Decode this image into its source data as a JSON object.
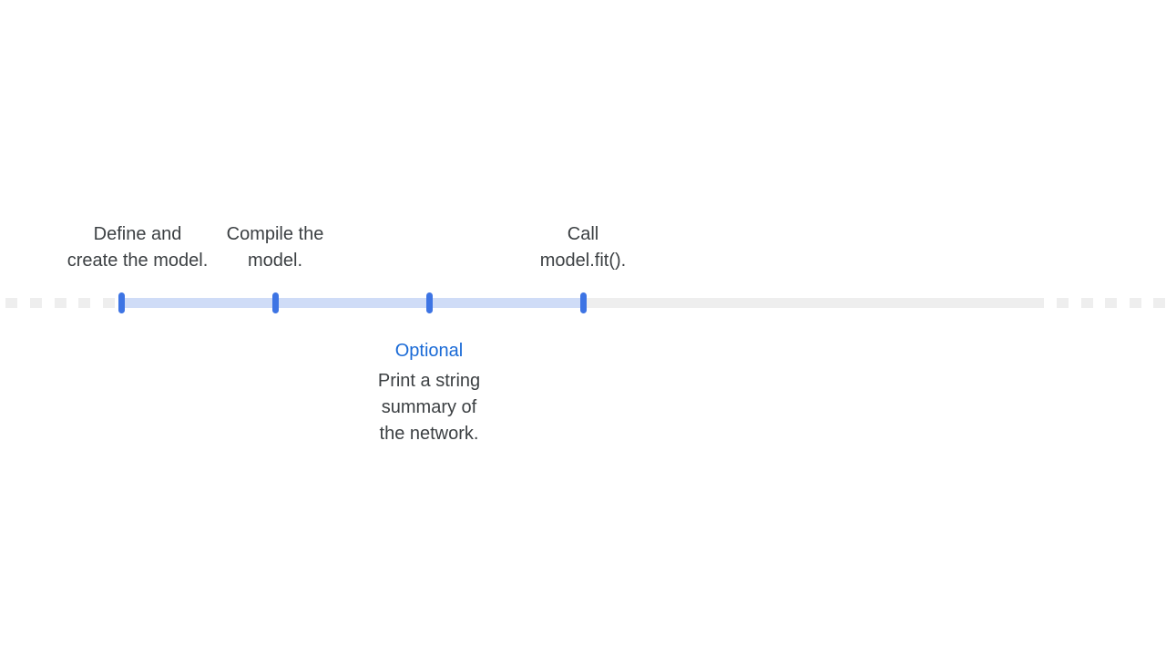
{
  "timeline": {
    "steps": [
      {
        "lines": [
          "Define and",
          "create the model."
        ],
        "position": "above"
      },
      {
        "lines": [
          "Compile the",
          "model."
        ],
        "position": "above"
      },
      {
        "tag": "Optional",
        "lines": [
          "Print a string",
          "summary of",
          "the network."
        ],
        "position": "below"
      },
      {
        "lines": [
          "Call",
          "model.fit()."
        ],
        "position": "above"
      }
    ],
    "progress_fraction": 0.5,
    "colors": {
      "tick": "#3d74e4",
      "track_active": "#cfdcf7",
      "track_inactive": "#eeeeee",
      "optional_tag": "#1a6ad6",
      "text": "#3c4043"
    }
  }
}
